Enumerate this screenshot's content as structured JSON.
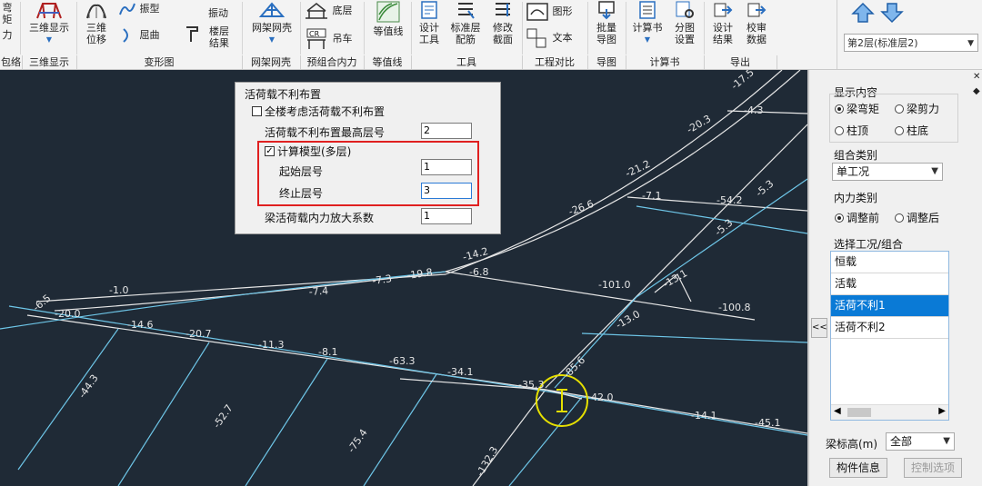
{
  "ribbon": {
    "buttons": {
      "moment_partial": "力",
      "moment_top_partial": "弯矩",
      "three_d_display": "三维显示",
      "three_d_displacement": "三维\n位移",
      "vibration": "振型",
      "buckling": "屈曲",
      "floor_result": "楼层\n结果",
      "vibration2": "振动",
      "grid_shell": "网架网壳",
      "bottom_floor": "底层",
      "crane": "吊车",
      "contour": "等值线",
      "design_tool": "设计\n工具",
      "std_floor_rebar": "标准层\n配筋",
      "modify_section": "修改\n截面",
      "figure": "图形",
      "text": "文本",
      "batch_export": "批量\n导图",
      "calc_book": "计算书",
      "sub_settings": "分图\n设置",
      "design_result": "设计\n结果",
      "review_data": "校审\n数据"
    },
    "groups": {
      "g0": "包络",
      "g1": "三维显示",
      "g2": "变形图",
      "g3": "网架网壳",
      "g4": "预组合内力",
      "g5": "等值线",
      "g6": "工具",
      "g7": "工程对比",
      "g8": "导图",
      "g9": "计算书",
      "g10": "导出"
    },
    "floor_select": "第2层(标准层2)"
  },
  "dialog": {
    "title": "活荷载不利布置",
    "all_floor_label": "全楼考虑活荷载不利布置",
    "all_floor_checked": false,
    "max_floor_label": "活荷载不利布置最高层号",
    "max_floor_value": "2",
    "calc_model_label": "计算模型(多层)",
    "calc_model_checked": true,
    "start_floor_label": "起始层号",
    "start_floor_value": "1",
    "end_floor_label": "终止层号",
    "end_floor_value": "3",
    "amplify_label": "梁活荷载内力放大系数",
    "amplify_value": "1"
  },
  "panel": {
    "display_title": "显示内容",
    "radio_beam_moment": "梁弯矩",
    "radio_beam_shear": "梁剪力",
    "radio_col_top": "柱顶",
    "radio_col_bottom": "柱底",
    "combo_title": "组合类别",
    "combo_value": "单工况",
    "force_title": "内力类别",
    "radio_before": "调整前",
    "radio_after": "调整后",
    "case_title": "选择工况/组合",
    "cases": [
      "恒载",
      "活载",
      "活荷不利1",
      "活荷不利2"
    ],
    "selected_case": "活荷不利1",
    "collapse_button": "<<",
    "beam_height_label": "梁标高(m)",
    "beam_height_value": "全部",
    "member_info_button": "构件信息",
    "control_options_button": "控制选项"
  },
  "canvas_labels": {
    "l01": "-17.5",
    "l02": "-4.3",
    "l03": "-20.3",
    "l04": "-21.2",
    "l05": "-5.3",
    "l06": "-26.6",
    "l07": "-7.1",
    "l08": "-54.2",
    "l09": "-5.3",
    "l10": "-14.2",
    "l11": "-6.8",
    "l12": "-7.3",
    "l13": "-19.8",
    "l14": "-7.4",
    "l15": "-101.0",
    "l16": "-13.1",
    "l17": "-100.8",
    "l18": "-1.0",
    "l19": "-6.5",
    "l20": "-20.0",
    "l21": "-13.0",
    "l22": "-14.6",
    "l23": "-20.7",
    "l24": "-11.3",
    "l25": "-8.1",
    "l26": "-63.3",
    "l27": "-34.1",
    "l28": "-35.3",
    "l29": "-85.6",
    "l30": "42.0",
    "l31": "-14.1",
    "l32": "-45.1",
    "l33": "-44.3",
    "l34": "-52.7",
    "l35": "-75.4",
    "l36": "-132.3"
  },
  "colors": {
    "canvas_bg": "#1f2a36",
    "beam_white": "#e6e6e6",
    "beam_cyan": "#6ec6e8",
    "highlight_red": "#e02020",
    "cursor_yellow": "#e6e000",
    "selected_case": "#0a7ad6"
  }
}
